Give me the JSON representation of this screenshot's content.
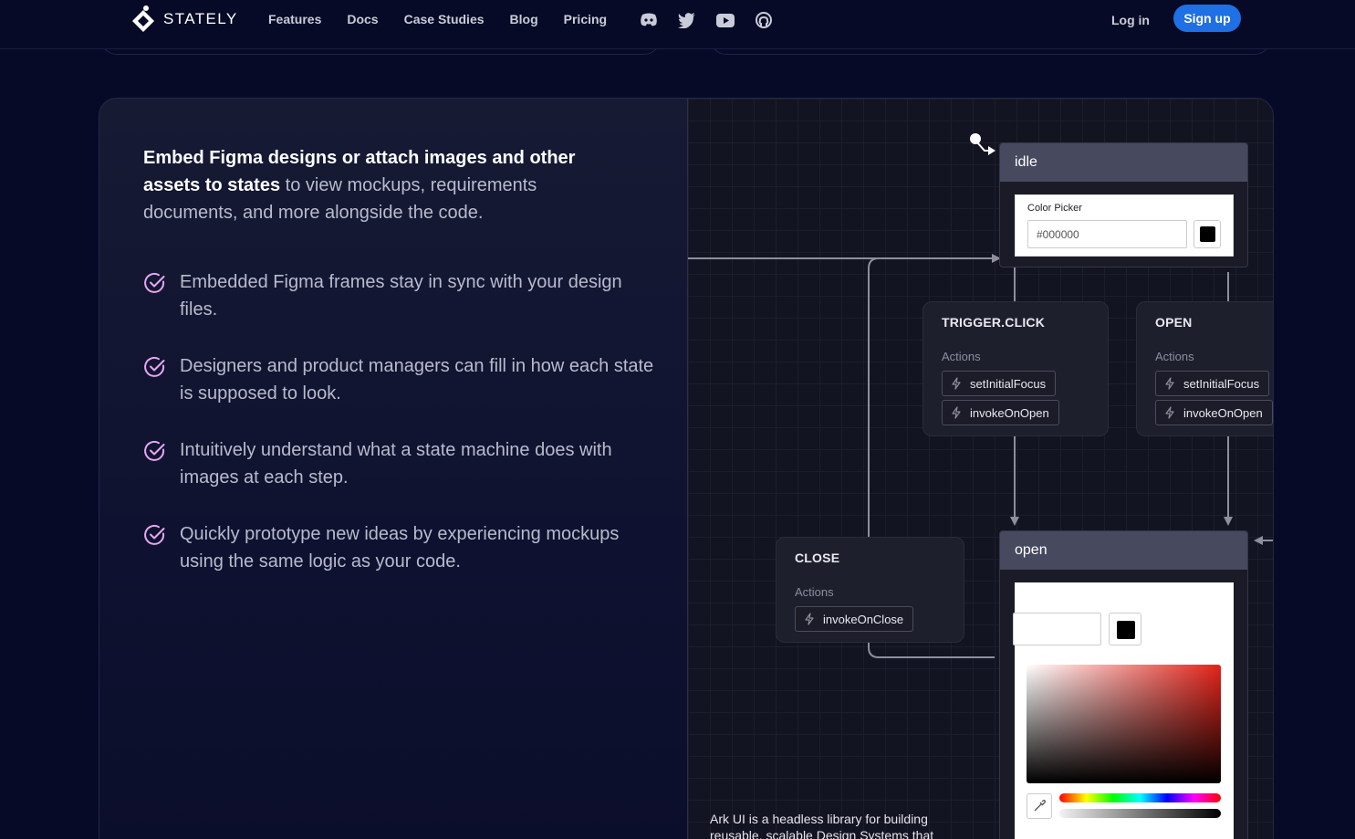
{
  "nav": {
    "brand": "STATELY",
    "links": [
      "Features",
      "Docs",
      "Case Studies",
      "Blog",
      "Pricing"
    ],
    "icons": [
      "discord-icon",
      "twitter-icon",
      "youtube-icon",
      "github-icon"
    ],
    "login": "Log in",
    "signup": "Sign up"
  },
  "intro": {
    "bold": "Embed Figma designs or attach images and other assets to states",
    "rest": " to view mockups, requirements documents, and more alongside the code."
  },
  "features": [
    "Embedded Figma frames stay in sync with your design files.",
    "Designers and product managers can fill in how each state is supposed to look.",
    "Intuitively understand what a state machine does with images at each step.",
    "Quickly prototype new ideas by experiencing mockups using the same logic as your code."
  ],
  "diagram": {
    "idle": {
      "name": "idle",
      "picker_title": "Color Picker",
      "input_value": "#000000"
    },
    "transitions": {
      "trigger_click": {
        "title": "TRIGGER.CLICK",
        "actions_label": "Actions",
        "actions": [
          "setInitialFocus",
          "invokeOnOpen"
        ]
      },
      "open": {
        "title": "OPEN",
        "actions_label": "Actions",
        "actions": [
          "setInitialFocus",
          "invokeOnOpen"
        ]
      },
      "close": {
        "title": "CLOSE",
        "actions_label": "Actions",
        "actions": [
          "invokeOnClose"
        ]
      }
    },
    "open_state": {
      "name": "open"
    },
    "description": "Ark UI is a headless library for building reusable, scalable Design Systems that"
  },
  "colors": {
    "background": "#070a26",
    "accent": "#1f6fe5",
    "check": "#e7a6f2"
  }
}
